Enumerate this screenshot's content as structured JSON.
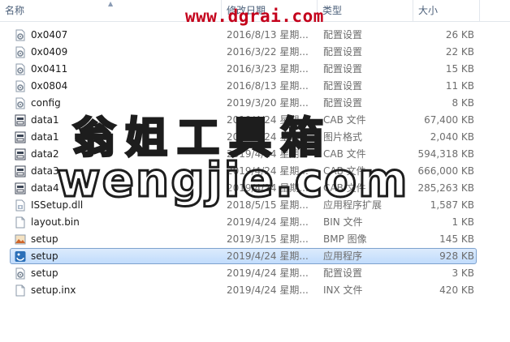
{
  "header": {
    "name": "名称",
    "date": "修改日期",
    "type": "类型",
    "size": "大小"
  },
  "files": [
    {
      "name": "0x0407",
      "date": "2016/8/13 星期...",
      "type": "配置设置",
      "size": "26 KB",
      "icon": "config-gear-icon"
    },
    {
      "name": "0x0409",
      "date": "2016/3/22 星期...",
      "type": "配置设置",
      "size": "22 KB",
      "icon": "config-gear-icon"
    },
    {
      "name": "0x0411",
      "date": "2016/3/23 星期...",
      "type": "配置设置",
      "size": "15 KB",
      "icon": "config-gear-icon"
    },
    {
      "name": "0x0804",
      "date": "2016/8/13 星期...",
      "type": "配置设置",
      "size": "11 KB",
      "icon": "config-gear-icon"
    },
    {
      "name": "config",
      "date": "2019/3/20 星期...",
      "type": "配置设置",
      "size": "8 KB",
      "icon": "config-gear-icon"
    },
    {
      "name": "data1",
      "date": "2019/4/24 星期...",
      "type": "CAB 文件",
      "size": "67,400 KB",
      "icon": "cab-archive-icon"
    },
    {
      "name": "data1",
      "date": "2019/4/24 星期...",
      "type": "图片格式",
      "size": "2,040 KB",
      "icon": "cab-archive-icon"
    },
    {
      "name": "data2",
      "date": "2019/4/24 星期...",
      "type": "CAB 文件",
      "size": "594,318 KB",
      "icon": "cab-archive-icon"
    },
    {
      "name": "data3",
      "date": "2019/4/24 星期...",
      "type": "CAB 文件",
      "size": "666,000 KB",
      "icon": "cab-archive-icon"
    },
    {
      "name": "data4",
      "date": "2019/4/24 星期...",
      "type": "CAB 文件",
      "size": "285,263 KB",
      "icon": "cab-archive-icon"
    },
    {
      "name": "ISSetup.dll",
      "date": "2018/5/15 星期...",
      "type": "应用程序扩展",
      "size": "1,587 KB",
      "icon": "dll-file-icon"
    },
    {
      "name": "layout.bin",
      "date": "2019/4/24 星期...",
      "type": "BIN 文件",
      "size": "1 KB",
      "icon": "blank-file-icon"
    },
    {
      "name": "setup",
      "date": "2019/3/15 星期...",
      "type": "BMP 图像",
      "size": "145 KB",
      "icon": "bmp-image-icon"
    },
    {
      "name": "setup",
      "date": "2019/4/24 星期...",
      "type": "应用程序",
      "size": "928 KB",
      "icon": "setup-app-icon",
      "selected": true
    },
    {
      "name": "setup",
      "date": "2019/4/24 星期...",
      "type": "配置设置",
      "size": "3 KB",
      "icon": "config-gear-icon"
    },
    {
      "name": "setup.inx",
      "date": "2019/4/24 星期...",
      "type": "INX 文件",
      "size": "420 KB",
      "icon": "blank-file-icon"
    }
  ],
  "watermarks": {
    "url": "www.dgrai.com",
    "chinese": "翁姐工具箱",
    "english": "wengjie.com"
  },
  "colors": {
    "selection": "#c1dcfc",
    "header_text": "#4c607a",
    "watermark_red": "#c4001b"
  }
}
